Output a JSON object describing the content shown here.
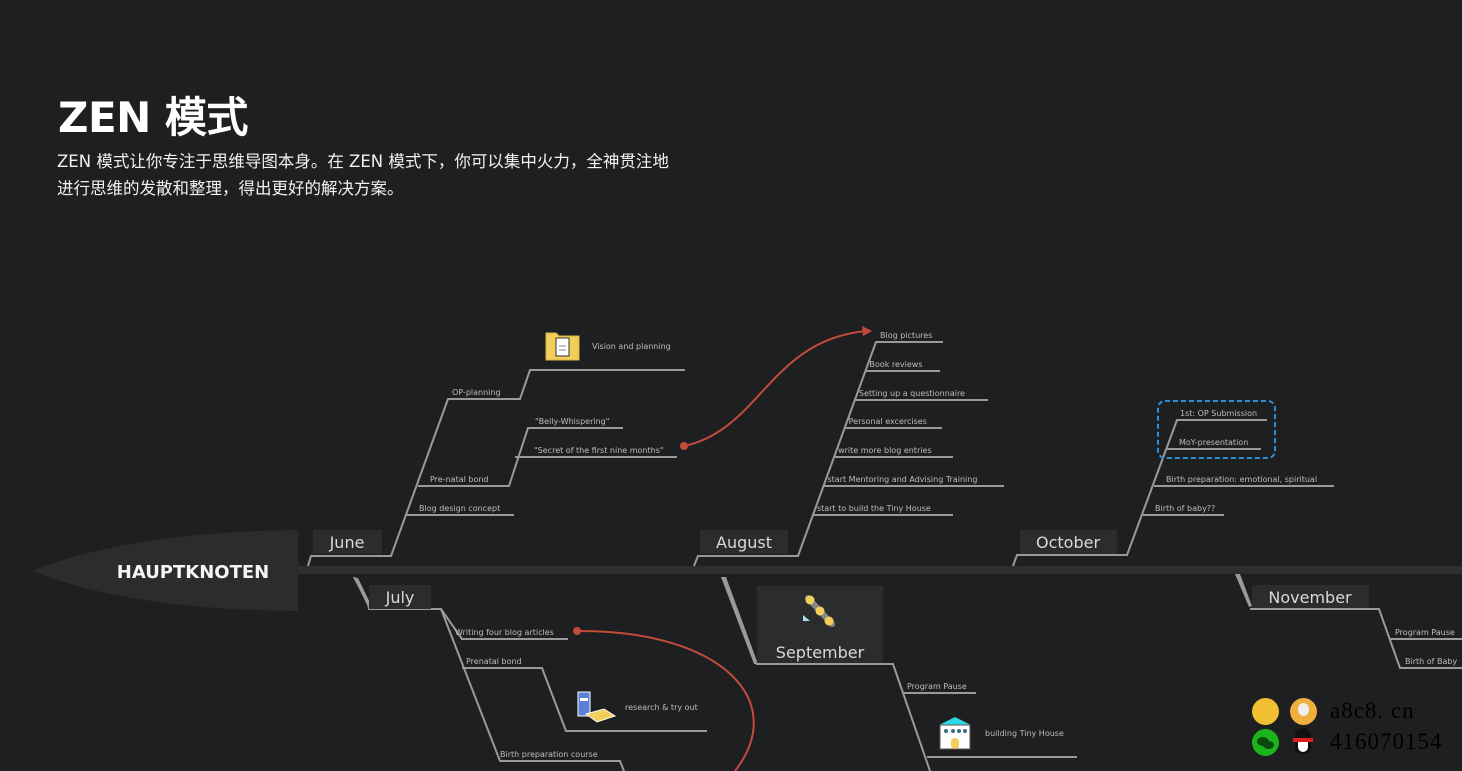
{
  "header": {
    "title": "ZEN 模式",
    "description_line1": "ZEN 模式让你专注于思维导图本身。在 ZEN 模式下，你可以集中火力，全神贯注地",
    "description_line2": "进行思维的发散和整理，得出更好的解决方案。"
  },
  "mindmap": {
    "root": "HAUPTKNOTEN",
    "months": {
      "june": {
        "label": "June",
        "topics": {
          "op_planning": "OP-planning",
          "vision": "Vision and planning",
          "belly": "\"Belly-Whispering\"",
          "secret": "\"Secret of the first nine months\"",
          "prenatal": "Pre-natal bond",
          "blog_design": "Blog design concept"
        }
      },
      "july": {
        "label": "July",
        "topics": {
          "writing": "Writing four blog articles",
          "prenatal": "Prenatal bond",
          "research": "research & try out",
          "birth_course": "Birth preparation course"
        }
      },
      "august": {
        "label": "August",
        "topics": [
          "Blog pictures",
          "Book reviews",
          "Setting up a questionnaire",
          "Personal excercises",
          "write more blog entries",
          "start Mentoring and Advising Training",
          "start to build the Tiny House"
        ]
      },
      "september": {
        "label": "September",
        "topics": {
          "pause": "Program Pause",
          "tiny_house": "building Tiny House"
        }
      },
      "october": {
        "label": "October",
        "topics": [
          "1st: OP Submission",
          "MoY-presentation",
          "Birth preparation: emotional, spiritual",
          "Birth of baby??"
        ]
      },
      "november": {
        "label": "November",
        "topics": [
          "Program Pause",
          "Birth of Baby"
        ]
      }
    },
    "icons": {
      "vision": "folder-document-icon",
      "research": "books-icon",
      "september": "skateboard-icon",
      "tiny_house": "house-icon"
    },
    "colors": {
      "background": "#1e1f21",
      "branch": "#9a9a9a",
      "relationship": "#c24b3c",
      "boundary": "#2b8fd6",
      "node_fill": "#2b2c2e"
    }
  },
  "watermark": {
    "site": "a8c8. cn",
    "qq": "416070154"
  }
}
